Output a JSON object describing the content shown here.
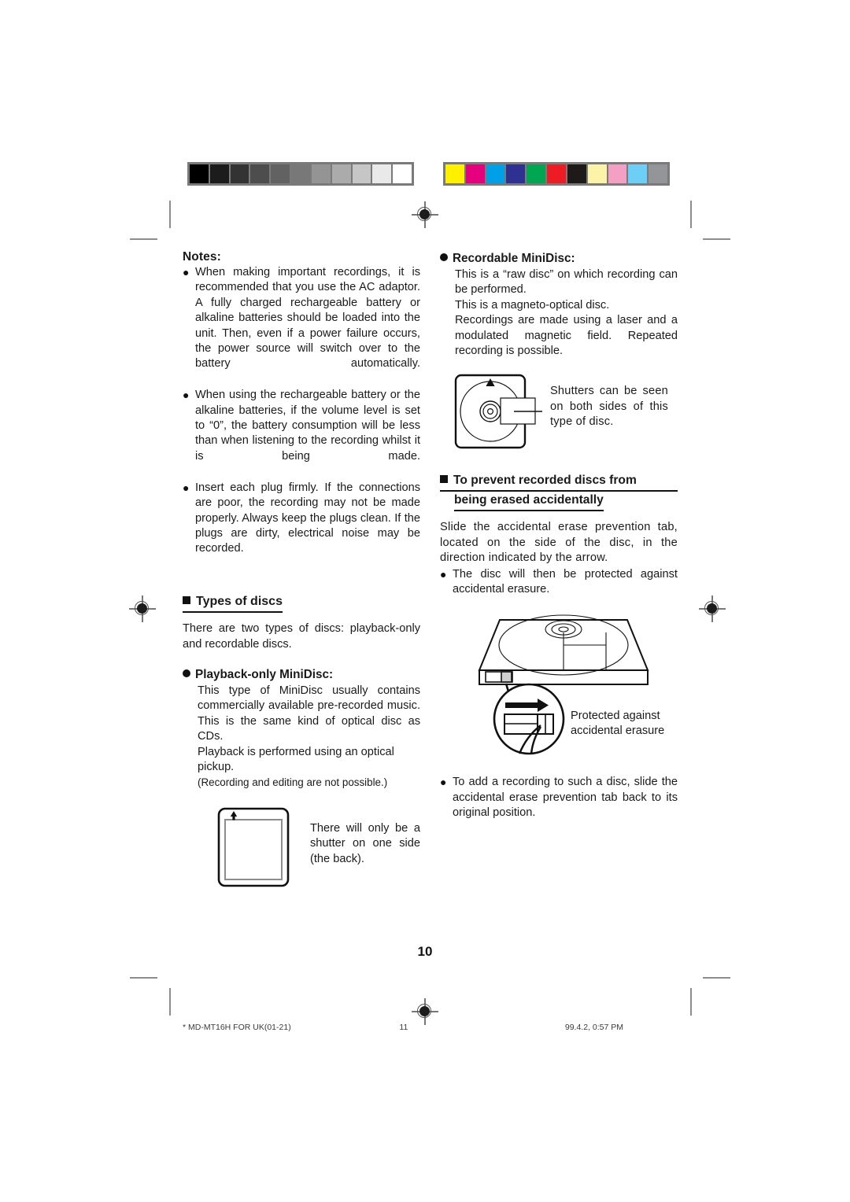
{
  "document": {
    "page_number": "10",
    "footer": {
      "file_label": "*  MD-MT16H FOR UK(01-21)",
      "sheet_number": "11",
      "timestamp": "99.4.2, 0:57 PM"
    }
  },
  "print_marks": {
    "grayscale_strip": {
      "name": "grayscale-calibration-strip",
      "swatches": [
        "#000000",
        "#1c1c1c",
        "#333333",
        "#4d4d4d",
        "#626262",
        "#787878",
        "#949494",
        "#ababab",
        "#c6c6c6",
        "#e9e9e9",
        "#ffffff"
      ]
    },
    "color_strip": {
      "name": "color-calibration-strip",
      "swatches": [
        "#fff000",
        "#e5007e",
        "#00a0e9",
        "#2e3192",
        "#00a651",
        "#ed1c24",
        "#1f1a1a",
        "#fcf3a8",
        "#f4a0c4",
        "#6ecff6",
        "#939598"
      ]
    }
  },
  "left_column": {
    "notes_label": "Notes:",
    "notes": [
      "When making important recordings, it is recommended that you use the AC adaptor. A fully charged rechargeable battery or alkaline batteries should be loaded into the unit. Then, even if a power failure occurs, the power source will switch over to the battery automatically.",
      "When using the rechargeable battery or the alkaline batteries, if the volume level is set to “0”, the battery consumption will be less than when listening to the recording whilst it is being made.",
      "Insert each plug firmly. If the connections are poor, the recording may not be made properly. Always keep the plugs clean. If the plugs are dirty, electrical noise may be recorded."
    ],
    "types_heading": "Types of discs",
    "types_intro": "There are two types of discs: playback-only and recordable discs.",
    "playback_heading": "Playback-only MiniDisc:",
    "playback_paragraphs": [
      "This type of MiniDisc usually contains commercially available pre-recorded music. This is the same kind of optical disc as CDs.",
      "Playback is performed using an optical pickup.",
      "(Recording and editing are not possible.)"
    ],
    "figure_caption": "There will only be a shutter on one side (the back)."
  },
  "right_column": {
    "recordable_heading": "Recordable MiniDisc:",
    "recordable_paragraphs": [
      "This is a “raw disc” on which recording can be performed.",
      "This is a magneto-optical disc.",
      "Recordings are made using a laser and a modulated magnetic field. Repeated recording is possible."
    ],
    "shutter_caption": "Shutters can be seen on both sides of this type of disc.",
    "prevent_heading_line1": "To prevent recorded discs from",
    "prevent_heading_line2": "being erased accidentally",
    "prevent_intro": "Slide the accidental erase prevention tab, located on the side of the disc, in the direction indicated by the arrow.",
    "prevent_bullet": "The disc will then be protected against accidental erasure.",
    "protected_caption_line1": "Protected against",
    "protected_caption_line2": "accidental erasure",
    "add_recording_bullet": "To add a recording to such a disc, slide the accidental erase prevention tab back to its original position."
  }
}
